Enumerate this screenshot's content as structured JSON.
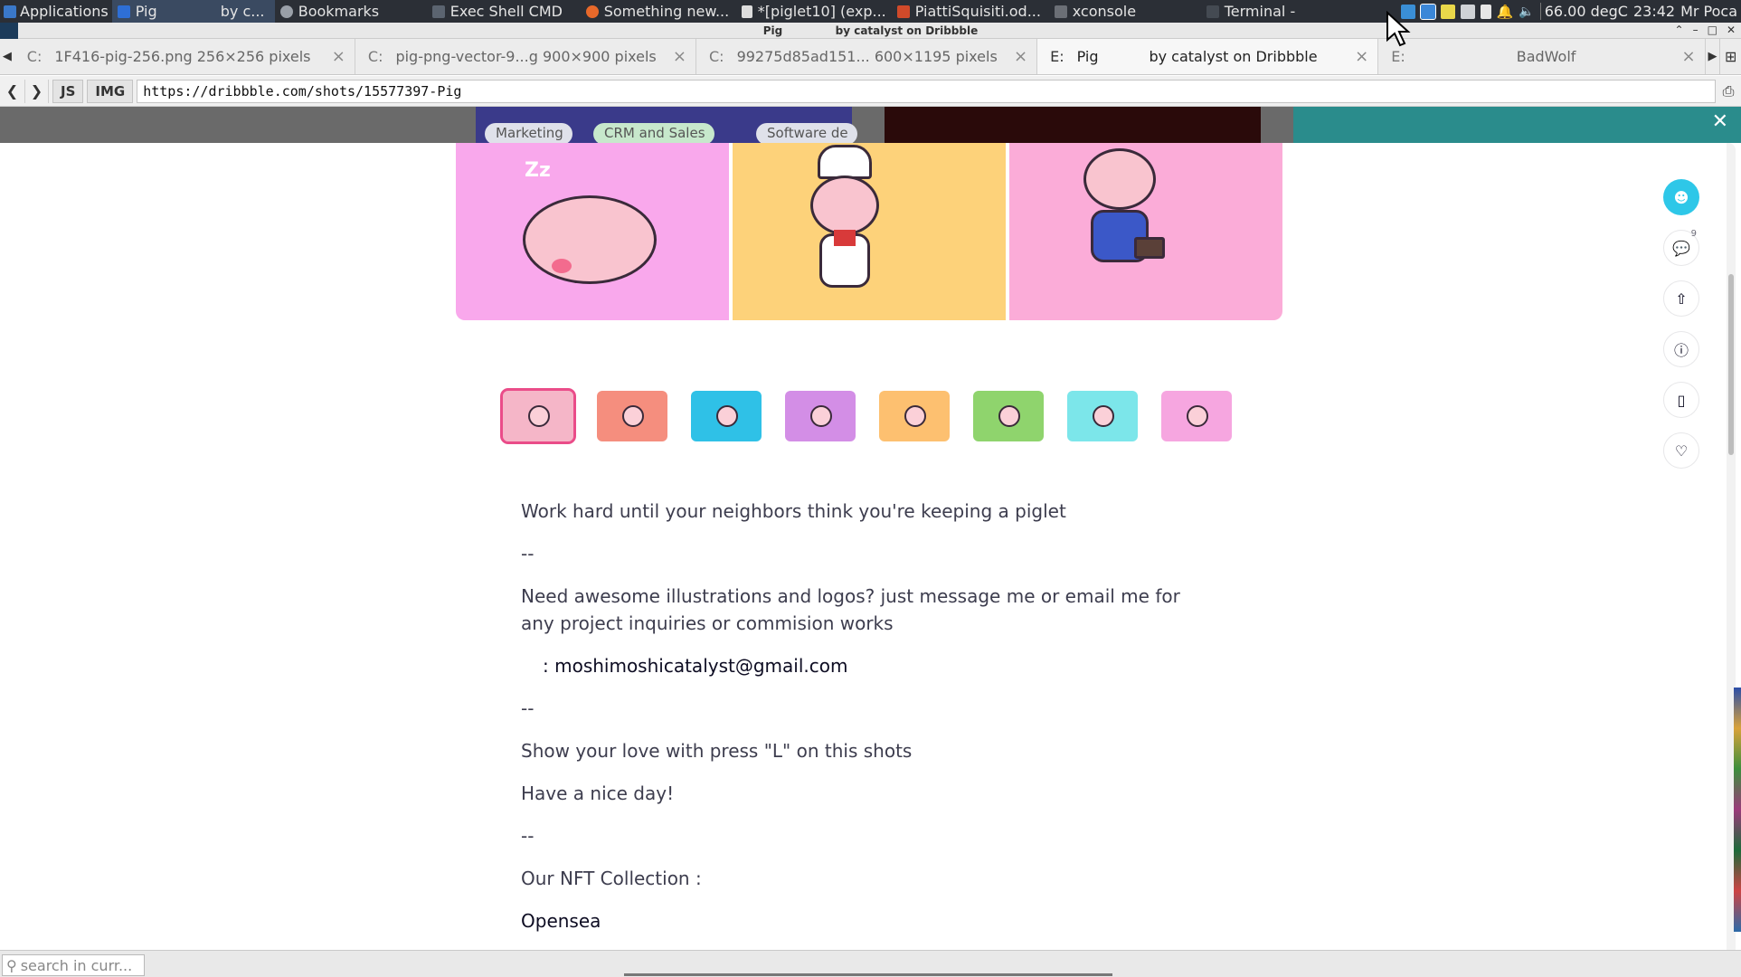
{
  "panel": {
    "applications": "Applications",
    "tasks": [
      {
        "label": "Pig",
        "icon": "browser-icon",
        "active": true
      },
      {
        "label": "by c...",
        "icon": "",
        "active": true
      },
      {
        "label": "Bookmarks",
        "icon": "bookmark-icon",
        "active": false
      },
      {
        "label": "Exec Shell CMD",
        "icon": "terminal-icon",
        "active": false
      },
      {
        "label": "Something new...",
        "icon": "firefox-icon",
        "active": false
      },
      {
        "label": "*[piglet10] (exp...",
        "icon": "editor-icon",
        "active": false
      },
      {
        "label": "PiattiSquisiti.od...",
        "icon": "document-icon",
        "active": false
      },
      {
        "label": "xconsole",
        "icon": "console-icon",
        "active": false
      },
      {
        "label": "Terminal -",
        "icon": "terminal-icon",
        "active": false
      }
    ],
    "temperature": "66.00 degC",
    "clock": "23:42",
    "user": "Mr Poca"
  },
  "window": {
    "title_left": "Pig",
    "title_right": "by catalyst on Dribbble"
  },
  "tabs": [
    {
      "prefix": "C:",
      "title": "1F416-pig-256.png 256×256 pixels",
      "active": false
    },
    {
      "prefix": "C:",
      "title": "pig-png-vector-9...g 900×900 pixels",
      "active": false
    },
    {
      "prefix": "C:",
      "title": "99275d85ad151... 600×1195 pixels",
      "active": false
    },
    {
      "prefix": "E:",
      "title": "Pig           by catalyst on Dribbble",
      "active": true
    },
    {
      "prefix": "E:",
      "title": "BadWolf",
      "active": false
    }
  ],
  "nav": {
    "js_label": "JS",
    "img_label": "IMG",
    "url": "https://dribbble.com/shots/15577397-Pig"
  },
  "bg_chips": [
    "Marketing",
    "CRM and Sales",
    "Software de"
  ],
  "shot": {
    "panel_colors": [
      "#f9a8ec",
      "#fdd27a",
      "#fbacd8"
    ],
    "thumb_colors": [
      "#f5b6c8",
      "#f58e7e",
      "#2fc1e7",
      "#d38ee6",
      "#fdc070",
      "#8fd46d",
      "#7ce6ea",
      "#f6a6e0"
    ],
    "description": [
      "Work hard until your neighbors think you're keeping a piglet",
      "--",
      "Need awesome illustrations and logos? just message me or email me for any project inquiries or commision works",
      ": moshimoshicatalyst@gmail.com",
      "--",
      "Show your love with press \"L\" on this shots",
      "Have a nice day!",
      "--",
      "Our NFT Collection :",
      "Opensea"
    ]
  },
  "sidebar": {
    "comment_count": "9"
  },
  "findbar": {
    "placeholder": "search in curr..."
  }
}
